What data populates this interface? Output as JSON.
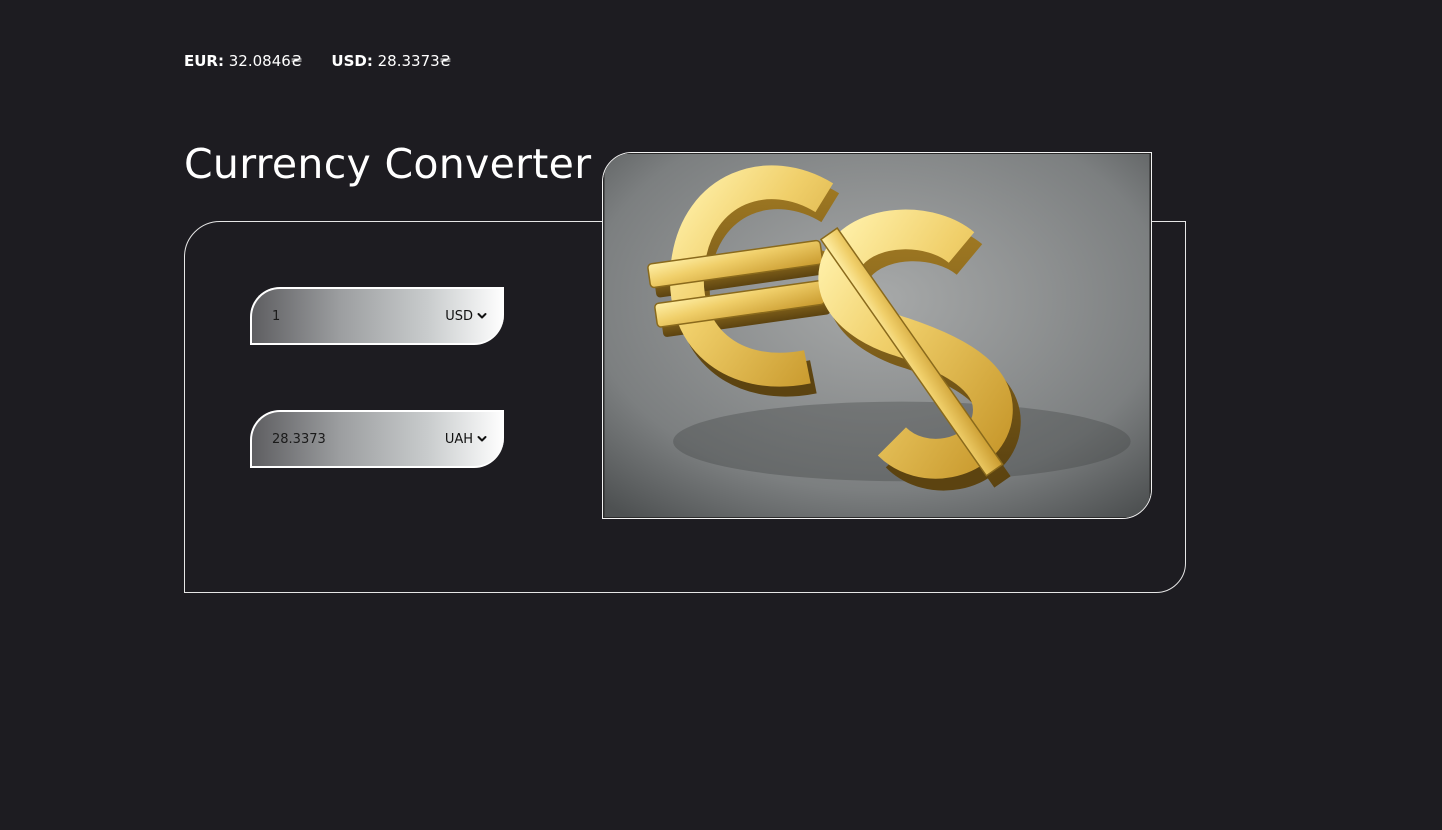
{
  "rates": [
    {
      "label": "EUR:",
      "value": "32.0846₴"
    },
    {
      "label": "USD:",
      "value": "28.3373₴"
    }
  ],
  "title": "Currency Converter",
  "converter": {
    "from": {
      "amount": "1",
      "currency": "USD"
    },
    "to": {
      "amount": "28.3373",
      "currency": "UAH"
    }
  },
  "icons": {
    "dropdown": "chevron-down-icon",
    "illustration": "euro-dollar-gold-signs"
  },
  "colors": {
    "background": "#1d1c21",
    "text": "#ffffff",
    "gold": "#e8c35a"
  }
}
